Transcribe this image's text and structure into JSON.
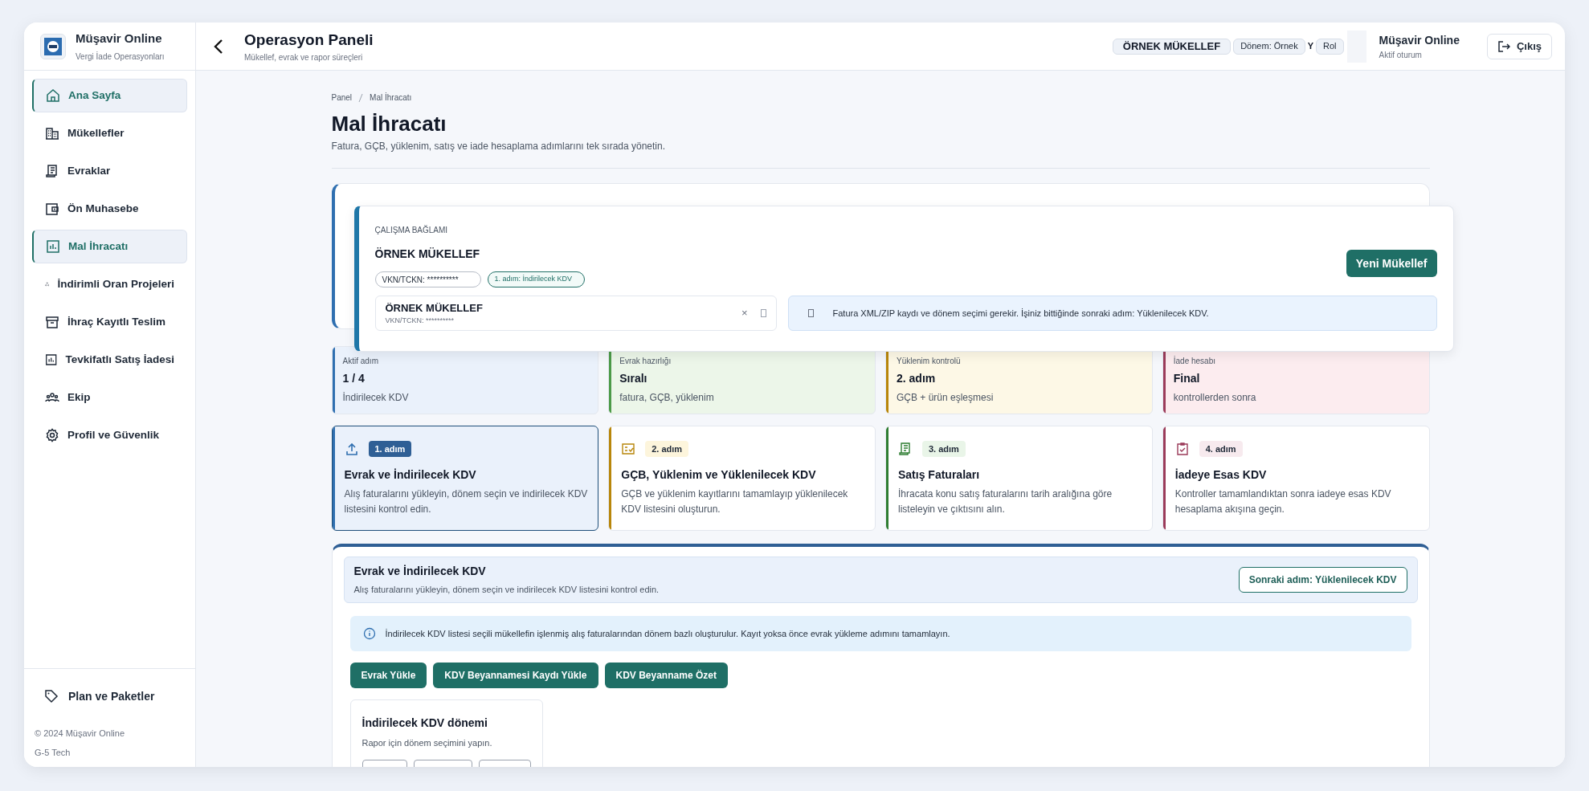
{
  "sidebar": {
    "brand": {
      "title": "Müşavir Online",
      "subtitle": "Vergi İade Operasyonları"
    },
    "items": [
      {
        "label": "Ana Sayfa",
        "selected": true
      },
      {
        "label": "Mükellefler",
        "selected": false
      },
      {
        "label": "Evraklar",
        "selected": false
      },
      {
        "label": "Ön Muhasebe",
        "selected": false
      },
      {
        "label": "Mal İhracatı",
        "selected": true
      },
      {
        "label": "İndirimli Oran Projeleri",
        "selected": false
      },
      {
        "label": "İhraç Kayıtlı Teslim",
        "selected": false
      },
      {
        "label": "Tevkifatlı Satış İadesi",
        "selected": false
      },
      {
        "label": "Ekip",
        "selected": false
      },
      {
        "label": "Profil ve Güvenlik",
        "selected": false
      }
    ],
    "footer_item": "Plan ve Paketler",
    "copyright": "© 2024 Müşavir Online",
    "company": "G-5 Tech"
  },
  "header": {
    "title": "Operasyon Paneli",
    "subtitle": "Mükellef, evrak ve rapor süreçleri",
    "pills": [
      {
        "text": "ÖRNEK MÜKELLEF",
        "kind": "strong"
      },
      {
        "text": "Dönem: Örnek",
        "kind": "plain"
      },
      {
        "text": "Y",
        "kind": "fragment"
      },
      {
        "text": "Rol",
        "kind": "plain"
      }
    ],
    "user": {
      "name": "Müşavir Online",
      "status": "Aktif oturum"
    },
    "logout": "Çıkış"
  },
  "breadcrumb": [
    "Panel",
    "Mal İhracatı"
  ],
  "page": {
    "title": "Mal İhracatı",
    "subtitle": "Fatura, GÇB, yüklenim, satış ve iade hesaplama adımlarını tek sırada yönetin."
  },
  "context": {
    "label": "ÇALIŞMA BAĞLAMI",
    "name": "ÖRNEK MÜKELLEF",
    "tags": [
      {
        "text": "VKN/TCKN: **********",
        "kind": "plain"
      },
      {
        "text": "1. adım: İndirilecek KDV",
        "kind": "step"
      }
    ],
    "selector": {
      "name": "ÖRNEK MÜKELLEF",
      "id": "VKN/TCKN: **********",
      "clear": "×"
    },
    "notice": "Fatura XML/ZIP kaydı ve dönem seçimi gerekir. İşiniz bittiğinde sonraki adım: Yüklenilecek KDV.",
    "button": "Yeni Mükellef"
  },
  "summary": [
    {
      "label": "Aktif adım",
      "value": "1 / 4",
      "note": "İndirilecek KDV",
      "color": "#2f6fb0"
    },
    {
      "label": "Evrak hazırlığı",
      "value": "Sıralı",
      "note": "fatura, GÇB, yüklenim",
      "color": "#4c9a48"
    },
    {
      "label": "Yüklenim kontrolü",
      "value": "2. adım",
      "note": "GÇB + ürün eşleşmesi",
      "color": "#b8860b"
    },
    {
      "label": "İade hesabı",
      "value": "Final",
      "note": "kontrollerden sonra",
      "color": "#9b3b5a"
    }
  ],
  "steps": [
    {
      "badge": "1. adım",
      "title": "Evrak ve İndirilecek KDV",
      "description": "Alış faturalarını yükleyin, dönem seçin ve indirilecek KDV listesini kontrol edin.",
      "selected": true,
      "color": "#2f6fb0"
    },
    {
      "badge": "2. adım",
      "title": "GÇB, Yüklenim ve Yüklenilecek KDV",
      "description": "GÇB ve yüklenim kayıtlarını tamamlayıp yüklenilecek KDV listesini oluşturun.",
      "selected": false,
      "color": "#b8860b"
    },
    {
      "badge": "3. adım",
      "title": "Satış Faturaları",
      "description": "İhracata konu satış faturalarını tarih aralığına göre listeleyin ve çıktısını alın.",
      "selected": false,
      "color": "#2e7d32"
    },
    {
      "badge": "4. adım",
      "title": "İadeye Esas KDV",
      "description": "Kontroller tamamlandıktan sonra iadeye esas KDV hesaplama akışına geçin.",
      "selected": false,
      "color": "#9b3b5a"
    }
  ],
  "section": {
    "title": "Evrak ve İndirilecek KDV",
    "subtitle": "Alış faturalarını yükleyin, dönem seçin ve indirilecek KDV listesini kontrol edin.",
    "next_button": "Sonraki adım: Yüklenilecek KDV",
    "info": "İndirilecek KDV listesi seçili mükellefin işlenmiş alış faturalarından dönem bazlı oluşturulur. Kayıt yoksa önce evrak yükleme adımını tamamlayın.",
    "actions": [
      "Evrak Yükle",
      "KDV Beyannamesi Kaydı Yükle",
      "KDV Beyanname Özet"
    ],
    "period_card": {
      "title": "İndirilecek KDV dönemi",
      "subtitle": "Rapor için dönem seçimini yapın."
    }
  }
}
